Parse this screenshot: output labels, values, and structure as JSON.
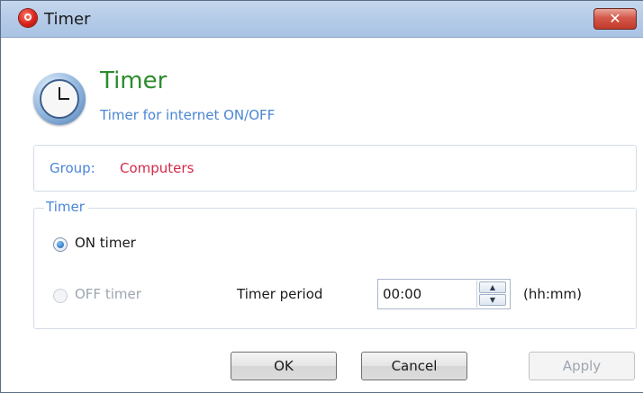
{
  "window": {
    "title": "Timer",
    "close_glyph": "✕"
  },
  "header": {
    "title": "Timer",
    "subtitle": "Timer for internet ON/OFF",
    "icon": "clock-icon"
  },
  "group": {
    "label": "Group:",
    "value": "Computers"
  },
  "timer": {
    "legend": "Timer",
    "on_label": "ON timer",
    "off_label": "OFF timer",
    "selected": "ON timer",
    "period_label": "Timer period",
    "period_value": "00:00",
    "units": "(hh:mm)",
    "spin_up_glyph": "▲",
    "spin_down_glyph": "▼"
  },
  "buttons": {
    "ok": "OK",
    "cancel": "Cancel",
    "apply": "Apply"
  },
  "colors": {
    "title_green": "#2e8b2e",
    "accent_blue": "#4a86d4",
    "group_value_red": "#d42a4a"
  }
}
